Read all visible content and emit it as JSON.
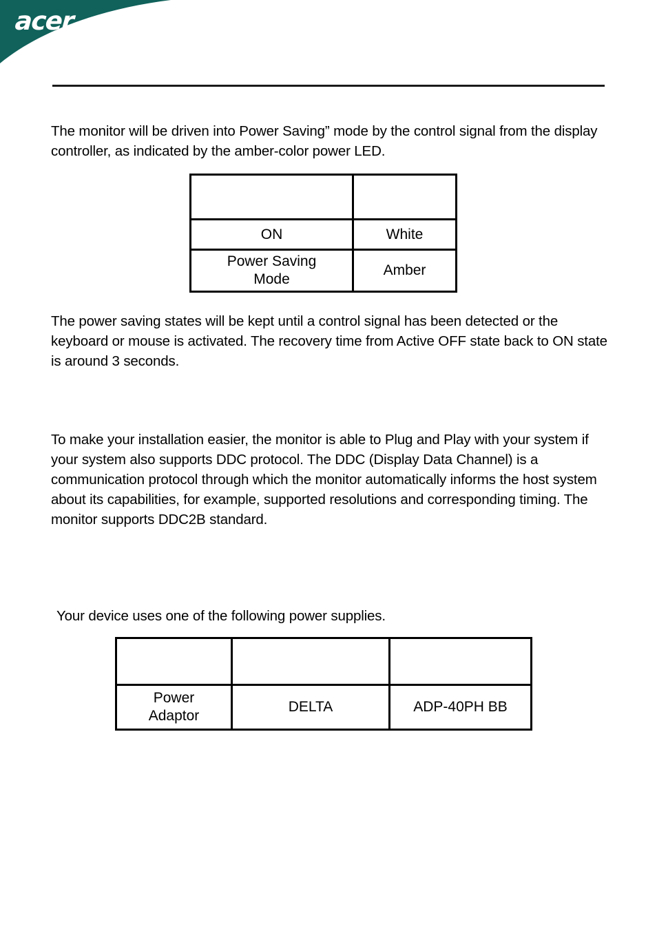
{
  "header": {
    "brand": "acer",
    "banner_color": "#10625B"
  },
  "divider": {
    "color": "#1a1a1a"
  },
  "content": {
    "power_saving_paragraph": "The monitor will be driven into Power Saving” mode by the control signal from the display controller, as indicated by the amber-color power LED.",
    "power_states_paragraph": "The power saving states will be kept until a control signal has been detected or the keyboard or mouse is activated. The recovery time from Active OFF state back to ON state is around 3 seconds.",
    "ddc_paragraph": "To make your installation easier, the monitor is able to Plug and Play with your system if your system also supports DDC protocol. The DDC (Display Data Channel) is a communication protocol through which the monitor automatically informs the host system  about its capabilities, for example, supported resolutions and corresponding timing. The monitor supports DDC2B standard.",
    "power_supplies_paragraph": "Your device uses one of the following power supplies."
  },
  "led_table": {
    "headers": [
      "",
      ""
    ],
    "rows": [
      {
        "state": "ON",
        "led_color": "White"
      },
      {
        "state": "Power Saving\nMode",
        "led_color": "Amber"
      }
    ]
  },
  "power_supply_table": {
    "headers": [
      "",
      "",
      ""
    ],
    "rows": [
      {
        "type": "Power\nAdaptor",
        "vendor": "DELTA",
        "model": "ADP-40PH BB"
      }
    ]
  }
}
